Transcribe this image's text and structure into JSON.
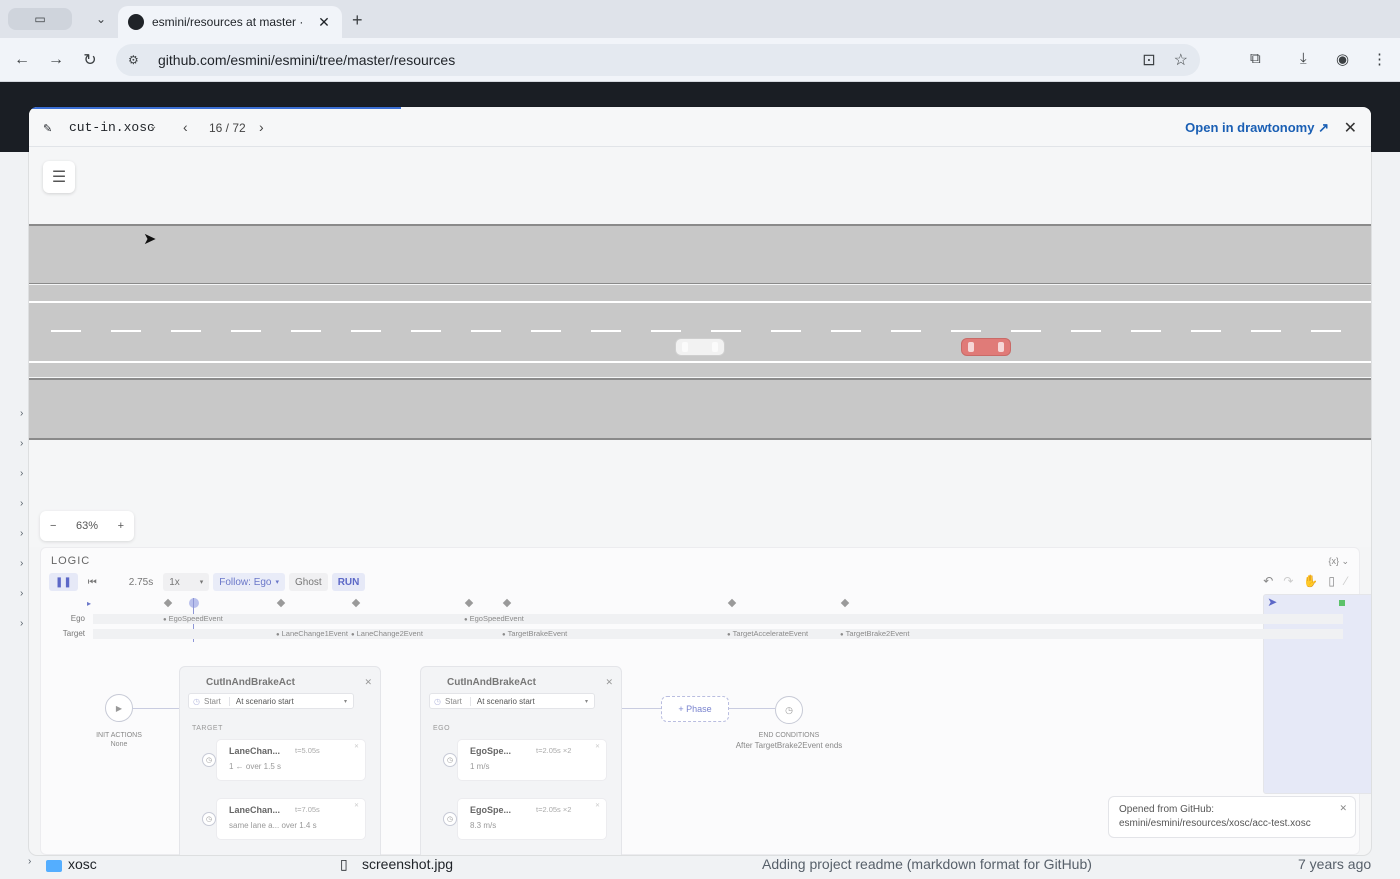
{
  "browser": {
    "tab_title": "esmini/resources at master · ",
    "url": "github.com/esmini/esmini/tree/master/resources"
  },
  "github_bg": {
    "folder_name": "xosc",
    "file_name": "screenshot.jpg",
    "commit_msg": "Adding project readme (markdown format for GitHub)",
    "age": "7 years ago"
  },
  "modal": {
    "filename": "cut-in.xosc",
    "counter": "16 / 72",
    "open_link": "Open in drawtonomy"
  },
  "canvas": {
    "zoom_level": "63%"
  },
  "logic": {
    "title": "LOGIC",
    "vars_label": "{x}",
    "time": "2.75s",
    "speed": "1x",
    "follow": "Follow: Ego",
    "ghost": "Ghost",
    "run": "RUN",
    "timeline": {
      "rows": [
        {
          "label": "Ego",
          "events": [
            "EgoSpeedEvent",
            "EgoSpeedEvent"
          ]
        },
        {
          "label": "Target",
          "events": [
            "LaneChange1Event",
            "LaneChange2Event",
            "TargetBrakeEvent",
            "TargetAccelerateEvent",
            "TargetBrake2Event"
          ]
        }
      ]
    },
    "init": {
      "label": "INIT ACTIONS",
      "value": "None"
    },
    "acts": [
      {
        "title": "CutInAndBrakeAct",
        "start_label": "Start",
        "start_value": "At scenario start",
        "group": "TARGET",
        "events": [
          {
            "name": "LaneChan...",
            "time": "t=5.05s",
            "detail": "1 ←   over 1.5 s"
          },
          {
            "name": "LaneChan...",
            "time": "t=7.05s",
            "detail": "same lane a...  over 1.4 s"
          }
        ]
      },
      {
        "title": "CutInAndBrakeAct",
        "start_label": "Start",
        "start_value": "At scenario start",
        "group": "EGO",
        "events": [
          {
            "name": "EgoSpe...",
            "time": "t=2.05s ×2",
            "detail": "1 m/s"
          },
          {
            "name": "EgoSpe...",
            "time": "t=2.05s ×2",
            "detail": "8.3 m/s"
          }
        ]
      }
    ],
    "phase_button": "+ Phase",
    "end": {
      "label": "END CONDITIONS",
      "value": "After TargetBrake2Event ends"
    }
  },
  "toast": {
    "title": "Opened from GitHub:",
    "path": "esmini/esmini/resources/xosc/acc-test.xosc"
  }
}
